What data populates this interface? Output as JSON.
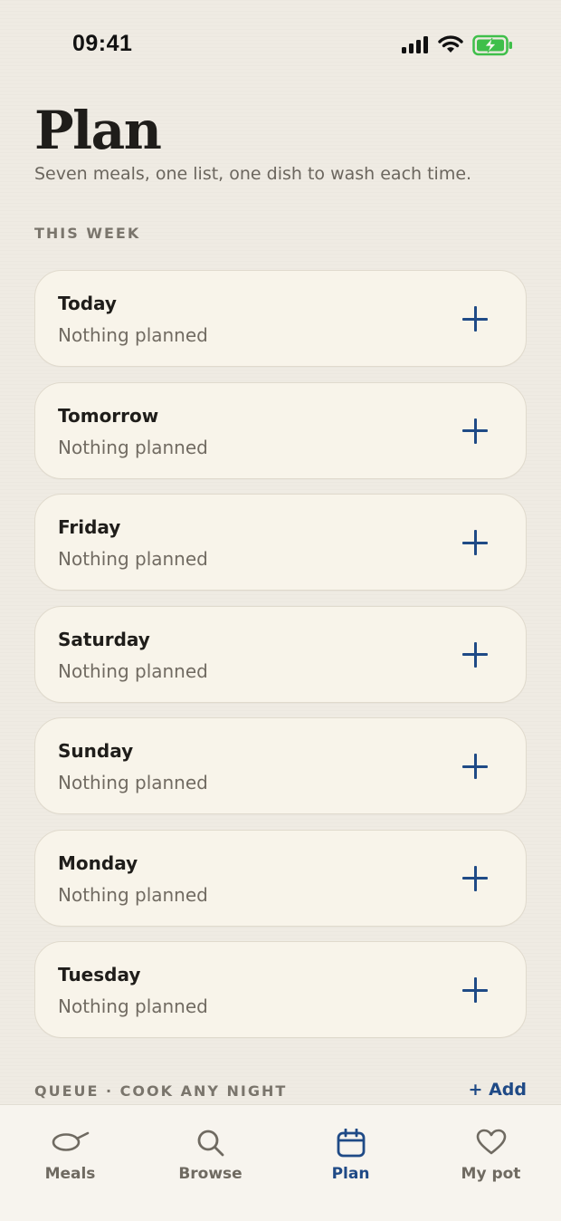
{
  "status_bar": {
    "time": "09:41"
  },
  "header": {
    "title": "Plan",
    "subtitle": "Seven meals, one list, one dish to wash each time."
  },
  "week": {
    "label": "THIS WEEK",
    "days": [
      {
        "name": "Today",
        "status": "Nothing planned"
      },
      {
        "name": "Tomorrow",
        "status": "Nothing planned"
      },
      {
        "name": "Friday",
        "status": "Nothing planned"
      },
      {
        "name": "Saturday",
        "status": "Nothing planned"
      },
      {
        "name": "Sunday",
        "status": "Nothing planned"
      },
      {
        "name": "Monday",
        "status": "Nothing planned"
      },
      {
        "name": "Tuesday",
        "status": "Nothing planned"
      }
    ]
  },
  "queue": {
    "label": "QUEUE · COOK ANY NIGHT",
    "add_label": "+ Add"
  },
  "tabs": [
    {
      "label": "Meals",
      "icon": "pan-icon",
      "active": false
    },
    {
      "label": "Browse",
      "icon": "search-icon",
      "active": false
    },
    {
      "label": "Plan",
      "icon": "calendar-icon",
      "active": true
    },
    {
      "label": "My pot",
      "icon": "heart-icon",
      "active": false
    }
  ],
  "colors": {
    "accent": "#1f4a86",
    "background": "#efebe3",
    "card": "#f8f4ea",
    "battery": "#3fbf4a"
  }
}
